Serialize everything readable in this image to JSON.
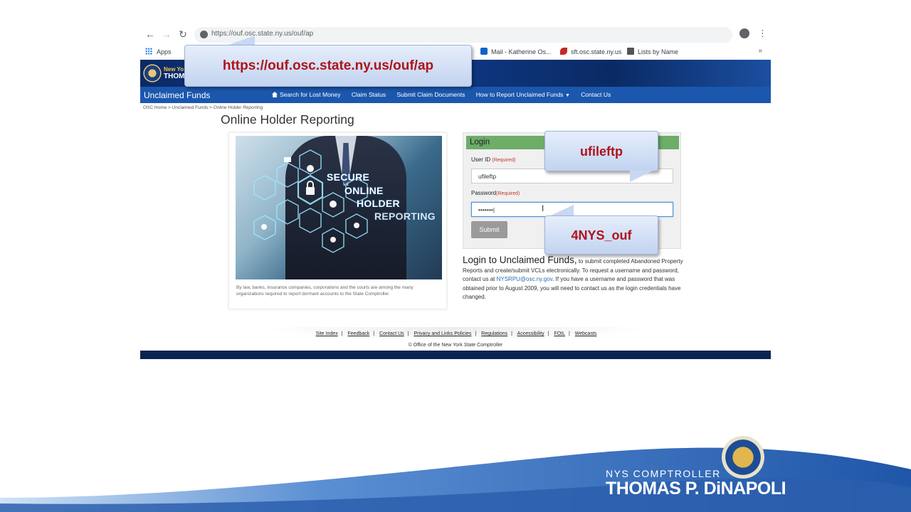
{
  "browser": {
    "url": "https://ouf.osc.state.ny.us/ouf/ap",
    "bookmarks": [
      {
        "label": "Apps"
      },
      {
        "label": "Mail - Katherine Os..."
      },
      {
        "label": "sft.osc.state.ny.us"
      },
      {
        "label": "Lists by Name"
      }
    ]
  },
  "site": {
    "header_line1": "New Yo",
    "header_line2": "THOM",
    "title": "Unclaimed Funds",
    "nav": [
      "Search for Lost Money",
      "Claim Status",
      "Submit Claim Documents",
      "How to Report Unclaimed Funds",
      "Contact Us"
    ],
    "breadcrumb": {
      "home": "OSC Home",
      "section": "Unclaimed Funds",
      "current": "Online Holder Reporting"
    },
    "page_title": "Online Holder Reporting"
  },
  "promo": {
    "lines": [
      "SECURE",
      "ONLINE",
      "HOLDER",
      "REPORTING"
    ],
    "caption": "By law, banks, insurance companies, corporations and the courts are among the many organizations required to report dormant accounts to the State Comptroller."
  },
  "login": {
    "heading": "Login",
    "userid_label": "User ID",
    "password_label": "Password",
    "required": "(Required)",
    "userid_value": "ufileftp",
    "password_value": "•••••••|",
    "submit_label": "Submit",
    "desc_title": "Login to Unclaimed Funds,",
    "desc_text1": " to submit completed Abandoned Property Reports and create/submit VCLs electronically. To request a username and password, contact us at ",
    "desc_email": "NYSRPU@osc.ny.gov",
    "desc_text2": ". If you have a username and password that was obtained prior to August 2009, you will need to contact us as the login credentials have changed."
  },
  "footer": {
    "links": [
      "Site Index",
      "Feedback",
      "Contact Us",
      "Privacy and Links Policies",
      "Regulations",
      "Accessibility",
      "FOIL",
      "Webcasts"
    ],
    "copyright": "© Office of the New York State Comptroller"
  },
  "callouts": {
    "url": "https://ouf.osc.state.ny.us/ouf/ap",
    "userid": "ufileftp",
    "password": "4NYS_ouf"
  },
  "branding": {
    "subtitle": "NYS COMPTROLLER",
    "name": "THOMAS P. DiNAPOLI"
  },
  "colors": {
    "header_blue": "#0f3a86",
    "nav_blue": "#1b57ad",
    "login_green": "#6dad68",
    "callout_text": "#b0121b"
  }
}
